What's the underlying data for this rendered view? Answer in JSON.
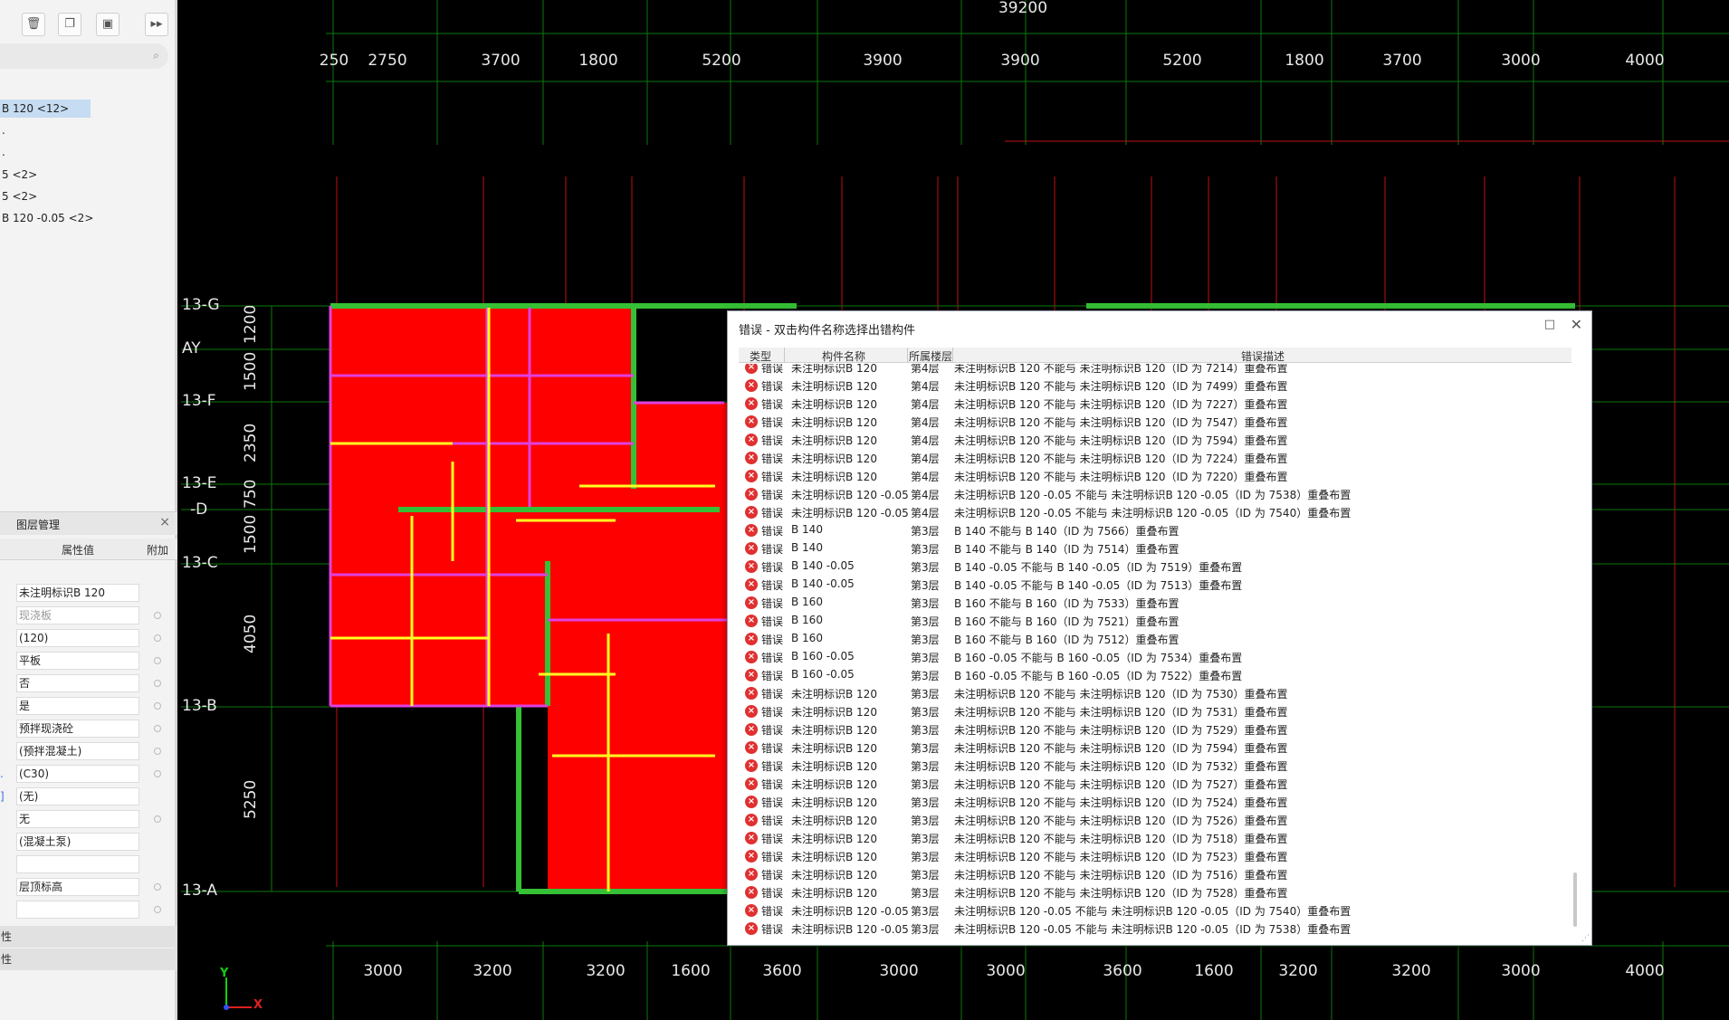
{
  "left_panel": {
    "toolbar": {
      "delete_icon": "trash-icon",
      "copy_icon": "copy-icon",
      "save_icon": "save-icon",
      "more_label": "▸▸"
    },
    "tree": [
      {
        "label": "B 120 <12>",
        "selected": true
      },
      {
        "label": "."
      },
      {
        "label": "."
      },
      {
        "label": "5 <2>"
      },
      {
        "label": "5 <2>"
      },
      {
        "label": "B 120 -0.05 <2>"
      }
    ],
    "layer_panel": {
      "title": "图层管理",
      "col_value": "属性值",
      "col_extra": "附加"
    },
    "properties": [
      {
        "value": "未注明标识B 120",
        "gray": false,
        "dot": false,
        "side": ""
      },
      {
        "value": "现浇板",
        "gray": true,
        "dot": true,
        "side": ""
      },
      {
        "value": "(120)",
        "gray": false,
        "dot": true,
        "side": ""
      },
      {
        "value": "平板",
        "gray": false,
        "dot": true,
        "side": ""
      },
      {
        "value": "否",
        "gray": false,
        "dot": true,
        "side": ""
      },
      {
        "value": "是",
        "gray": false,
        "dot": true,
        "side": ""
      },
      {
        "value": "预拌现浇砼",
        "gray": false,
        "dot": true,
        "side": ""
      },
      {
        "value": "(预拌混凝土)",
        "gray": false,
        "dot": true,
        "side": ""
      },
      {
        "value": "(C30)",
        "gray": false,
        "dot": true,
        "side": "."
      },
      {
        "value": "(无)",
        "gray": false,
        "dot": false,
        "side": "]"
      },
      {
        "value": "无",
        "gray": false,
        "dot": true,
        "side": ""
      },
      {
        "value": "(混凝土泵)",
        "gray": false,
        "dot": false,
        "side": ""
      },
      {
        "value": "",
        "gray": false,
        "dot": false,
        "side": ""
      },
      {
        "value": "层顶标高",
        "gray": false,
        "dot": true,
        "side": ""
      },
      {
        "value": "",
        "gray": false,
        "dot": true,
        "side": ""
      }
    ],
    "groups": [
      "性",
      "性"
    ]
  },
  "cad": {
    "total_top": "39200",
    "top_dims": [
      "250",
      "2750",
      "3700",
      "1800",
      "5200",
      "3900",
      "3900",
      "5200",
      "1800",
      "3700",
      "3000",
      "4000"
    ],
    "bottom_dims": [
      "3000",
      "3200",
      "3200",
      "1600",
      "3600",
      "3000",
      "3000",
      "3600",
      "1600",
      "3200",
      "3200",
      "3000",
      "4000"
    ],
    "axis_labels": [
      "13-G",
      "AY",
      "13-F",
      "13-E",
      "-D",
      "13-C",
      "13-B",
      "13-A"
    ],
    "side_dims": [
      "1200",
      "1500",
      "2350",
      "750",
      "1500",
      "4050",
      "5250"
    ],
    "gizmo": {
      "y": "Y",
      "x": "X"
    }
  },
  "dialog": {
    "title": "错误 - 双击构件名称选择出错构件",
    "max_icon": "□",
    "close_icon": "✕",
    "columns": {
      "type": "类型",
      "name": "构件名称",
      "floor": "所属楼层",
      "desc": "错误描述"
    },
    "rows": [
      {
        "type": "错误",
        "name": "未注明标识B 120",
        "floor": "第4层",
        "desc": "未注明标识B 120 不能与 未注明标识B 120（ID 为 7214）重叠布置"
      },
      {
        "type": "错误",
        "name": "未注明标识B 120",
        "floor": "第4层",
        "desc": "未注明标识B 120 不能与 未注明标识B 120（ID 为 7499）重叠布置"
      },
      {
        "type": "错误",
        "name": "未注明标识B 120",
        "floor": "第4层",
        "desc": "未注明标识B 120 不能与 未注明标识B 120（ID 为 7227）重叠布置"
      },
      {
        "type": "错误",
        "name": "未注明标识B 120",
        "floor": "第4层",
        "desc": "未注明标识B 120 不能与 未注明标识B 120（ID 为 7547）重叠布置"
      },
      {
        "type": "错误",
        "name": "未注明标识B 120",
        "floor": "第4层",
        "desc": "未注明标识B 120 不能与 未注明标识B 120（ID 为 7594）重叠布置"
      },
      {
        "type": "错误",
        "name": "未注明标识B 120",
        "floor": "第4层",
        "desc": "未注明标识B 120 不能与 未注明标识B 120（ID 为 7224）重叠布置"
      },
      {
        "type": "错误",
        "name": "未注明标识B 120",
        "floor": "第4层",
        "desc": "未注明标识B 120 不能与 未注明标识B 120（ID 为 7220）重叠布置"
      },
      {
        "type": "错误",
        "name": "未注明标识B 120 -0.05",
        "floor": "第4层",
        "desc": "未注明标识B 120 -0.05 不能与 未注明标识B 120 -0.05（ID 为 7538）重叠布置"
      },
      {
        "type": "错误",
        "name": "未注明标识B 120 -0.05",
        "floor": "第4层",
        "desc": "未注明标识B 120 -0.05 不能与 未注明标识B 120 -0.05（ID 为 7540）重叠布置"
      },
      {
        "type": "错误",
        "name": "B 140",
        "floor": "第3层",
        "desc": "B 140 不能与 B 140（ID 为 7566）重叠布置"
      },
      {
        "type": "错误",
        "name": "B 140",
        "floor": "第3层",
        "desc": "B 140 不能与 B 140（ID 为 7514）重叠布置"
      },
      {
        "type": "错误",
        "name": "B 140 -0.05",
        "floor": "第3层",
        "desc": "B 140 -0.05 不能与 B 140 -0.05（ID 为 7519）重叠布置"
      },
      {
        "type": "错误",
        "name": "B 140 -0.05",
        "floor": "第3层",
        "desc": "B 140 -0.05 不能与 B 140 -0.05（ID 为 7513）重叠布置"
      },
      {
        "type": "错误",
        "name": "B 160",
        "floor": "第3层",
        "desc": "B 160 不能与 B 160（ID 为 7533）重叠布置"
      },
      {
        "type": "错误",
        "name": "B 160",
        "floor": "第3层",
        "desc": "B 160 不能与 B 160（ID 为 7521）重叠布置"
      },
      {
        "type": "错误",
        "name": "B 160",
        "floor": "第3层",
        "desc": "B 160 不能与 B 160（ID 为 7512）重叠布置"
      },
      {
        "type": "错误",
        "name": "B 160 -0.05",
        "floor": "第3层",
        "desc": "B 160 -0.05 不能与 B 160 -0.05（ID 为 7534）重叠布置"
      },
      {
        "type": "错误",
        "name": "B 160 -0.05",
        "floor": "第3层",
        "desc": "B 160 -0.05 不能与 B 160 -0.05（ID 为 7522）重叠布置"
      },
      {
        "type": "错误",
        "name": "未注明标识B 120",
        "floor": "第3层",
        "desc": "未注明标识B 120 不能与 未注明标识B 120（ID 为 7530）重叠布置"
      },
      {
        "type": "错误",
        "name": "未注明标识B 120",
        "floor": "第3层",
        "desc": "未注明标识B 120 不能与 未注明标识B 120（ID 为 7531）重叠布置"
      },
      {
        "type": "错误",
        "name": "未注明标识B 120",
        "floor": "第3层",
        "desc": "未注明标识B 120 不能与 未注明标识B 120（ID 为 7529）重叠布置"
      },
      {
        "type": "错误",
        "name": "未注明标识B 120",
        "floor": "第3层",
        "desc": "未注明标识B 120 不能与 未注明标识B 120（ID 为 7594）重叠布置"
      },
      {
        "type": "错误",
        "name": "未注明标识B 120",
        "floor": "第3层",
        "desc": "未注明标识B 120 不能与 未注明标识B 120（ID 为 7532）重叠布置"
      },
      {
        "type": "错误",
        "name": "未注明标识B 120",
        "floor": "第3层",
        "desc": "未注明标识B 120 不能与 未注明标识B 120（ID 为 7527）重叠布置"
      },
      {
        "type": "错误",
        "name": "未注明标识B 120",
        "floor": "第3层",
        "desc": "未注明标识B 120 不能与 未注明标识B 120（ID 为 7524）重叠布置"
      },
      {
        "type": "错误",
        "name": "未注明标识B 120",
        "floor": "第3层",
        "desc": "未注明标识B 120 不能与 未注明标识B 120（ID 为 7526）重叠布置"
      },
      {
        "type": "错误",
        "name": "未注明标识B 120",
        "floor": "第3层",
        "desc": "未注明标识B 120 不能与 未注明标识B 120（ID 为 7518）重叠布置"
      },
      {
        "type": "错误",
        "name": "未注明标识B 120",
        "floor": "第3层",
        "desc": "未注明标识B 120 不能与 未注明标识B 120（ID 为 7523）重叠布置"
      },
      {
        "type": "错误",
        "name": "未注明标识B 120",
        "floor": "第3层",
        "desc": "未注明标识B 120 不能与 未注明标识B 120（ID 为 7516）重叠布置"
      },
      {
        "type": "错误",
        "name": "未注明标识B 120",
        "floor": "第3层",
        "desc": "未注明标识B 120 不能与 未注明标识B 120（ID 为 7528）重叠布置"
      },
      {
        "type": "错误",
        "name": "未注明标识B 120 -0.05",
        "floor": "第3层",
        "desc": "未注明标识B 120 -0.05 不能与 未注明标识B 120 -0.05（ID 为 7540）重叠布置"
      },
      {
        "type": "错误",
        "name": "未注明标识B 120 -0.05",
        "floor": "第3层",
        "desc": "未注明标识B 120 -0.05 不能与 未注明标识B 120 -0.05（ID 为 7538）重叠布置"
      }
    ]
  }
}
